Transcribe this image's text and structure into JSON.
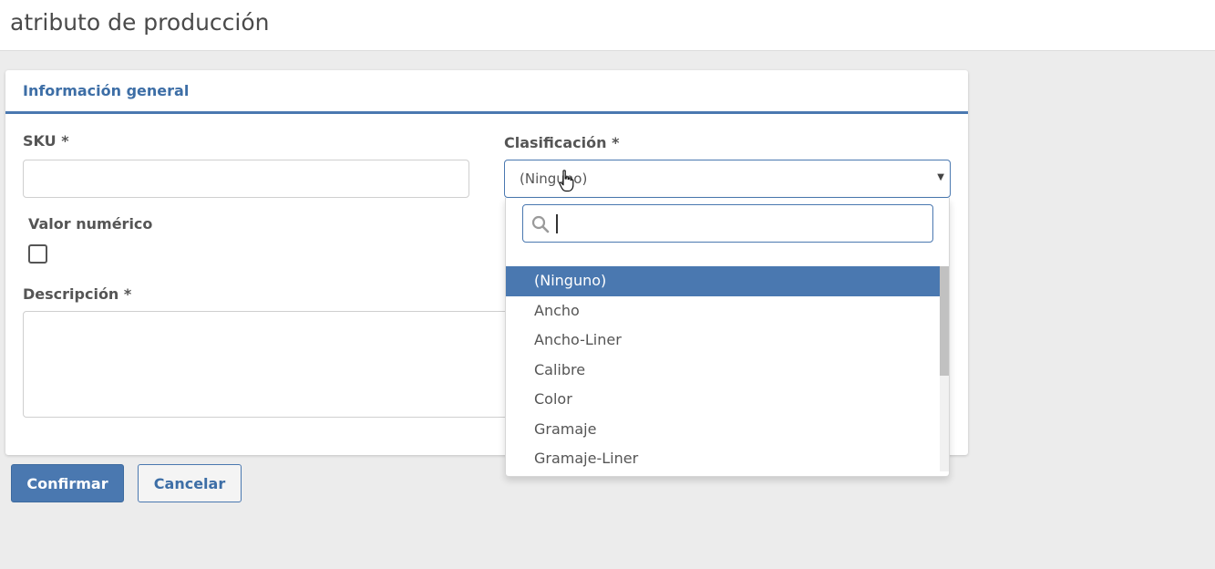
{
  "page": {
    "title": "atributo de producción"
  },
  "panel": {
    "title": "Información general"
  },
  "form": {
    "sku_label": "SKU *",
    "sku_value": "",
    "clasificacion_label": "Clasificación *",
    "clasificacion_value": "(Ninguno)",
    "valor_numerico_label": "Valor numérico",
    "valor_numerico_checked": false,
    "descripcion_label": "Descripción *",
    "descripcion_value": ""
  },
  "dropdown": {
    "search_value": "",
    "options": [
      "(Ninguno)",
      "Ancho",
      "Ancho-Liner",
      "Calibre",
      "Color",
      "Gramaje",
      "Gramaje-Liner"
    ],
    "selected_index": 0
  },
  "buttons": {
    "confirm_label": "Confirmar",
    "cancel_label": "Cancelar"
  },
  "colors": {
    "accent": "#4a78b0",
    "background": "#ececec"
  },
  "icons": {
    "select_arrow": "chevron-down-icon",
    "search": "search-icon",
    "cursor": "hand-pointer-icon"
  }
}
